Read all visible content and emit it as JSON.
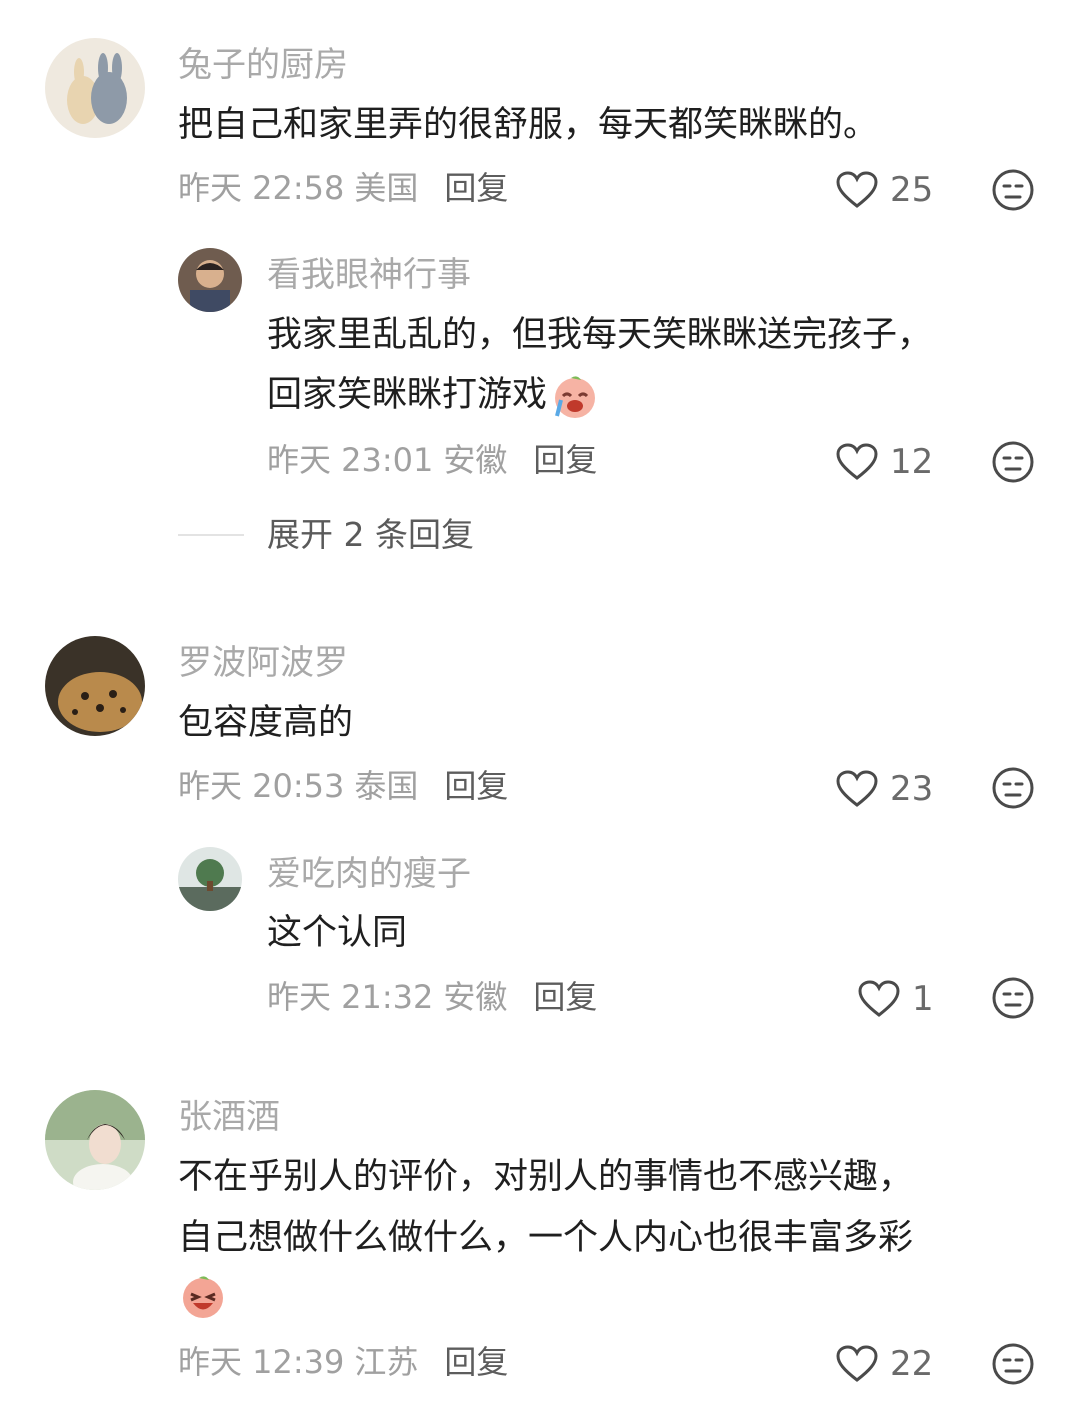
{
  "comments": [
    {
      "username": "兔子的厨房",
      "text": "把自己和家里弄的很舒服，每天都笑眯眯的。",
      "time": "昨天 22:58",
      "location": "美国",
      "reply_label": "回复",
      "likes": "25",
      "replies": [
        {
          "username": "看我眼神行事",
          "lines": [
            "我家里乱乱的，但我每天笑眯眯送完孩子，",
            "回家笑眯眯打游戏"
          ],
          "emoji": "crying-laugh-emoji",
          "time": "昨天 23:01",
          "location": "安徽",
          "reply_label": "回复",
          "likes": "12"
        }
      ],
      "expand_label": "展开 2 条回复"
    },
    {
      "username": "罗波阿波罗",
      "text": "包容度高的",
      "time": "昨天 20:53",
      "location": "泰国",
      "reply_label": "回复",
      "likes": "23",
      "replies": [
        {
          "username": "爱吃肉的瘦子",
          "lines": [
            "这个认同"
          ],
          "time": "昨天 21:32",
          "location": "安徽",
          "reply_label": "回复",
          "likes": "1"
        }
      ]
    },
    {
      "username": "张酒酒",
      "lines": [
        "不在乎别人的评价，对别人的事情也不感兴趣，",
        "自己想做什么做什么，一个人内心也很丰富多彩"
      ],
      "emoji": "laughing-emoji",
      "time": "昨天 12:39",
      "location": "江苏",
      "reply_label": "回复",
      "likes": "22"
    }
  ],
  "icons": {
    "like": "heart-icon",
    "dislike": "dislike-face-icon"
  },
  "colors": {
    "username": "#a9a9a9",
    "text": "#1f1f1f",
    "meta": "#a0a0a0",
    "reply": "#5d5d5d"
  }
}
